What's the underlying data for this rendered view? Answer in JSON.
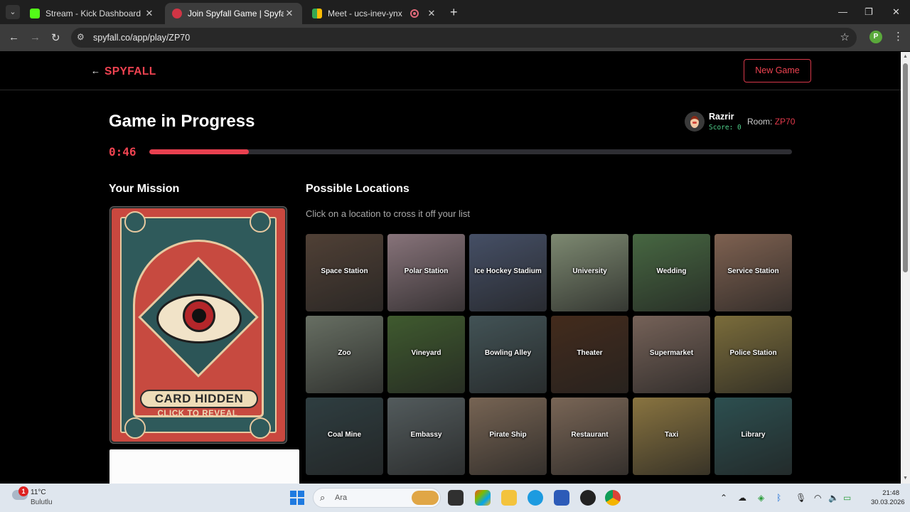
{
  "browser": {
    "tabs": [
      {
        "label": "Stream - Kick Dashboard",
        "active": false
      },
      {
        "label": "Join Spyfall Game | Spyfall Onli",
        "active": true
      },
      {
        "label": "Meet - ucs-inev-ynx",
        "active": false
      }
    ],
    "url": "spyfall.co/app/play/ZP70"
  },
  "header": {
    "brand": "SPYFALL",
    "new_game_label": "New Game"
  },
  "game": {
    "title": "Game in Progress",
    "timer": "0:46",
    "progress_fraction": 0.155,
    "player_name": "Razrir",
    "player_score": "Score: 0",
    "room_label": "Room:",
    "room_code": "ZP70"
  },
  "mission": {
    "title": "Your Mission",
    "card_text": "CARD HIDDEN",
    "card_subtext": "CLICK TO REVEAL"
  },
  "locations": {
    "title": "Possible Locations",
    "subtitle": "Click on a location to cross it off your list",
    "items": [
      {
        "label": "Space Station",
        "color": "#6b5648"
      },
      {
        "label": "Polar Station",
        "color": "#b59aa3"
      },
      {
        "label": "Ice Hockey Stadium",
        "color": "#5d6a88"
      },
      {
        "label": "University",
        "color": "#a7b797"
      },
      {
        "label": "Wedding",
        "color": "#5f8a58"
      },
      {
        "label": "Service Station",
        "color": "#a9826c"
      },
      {
        "label": "Zoo",
        "color": "#8a9484"
      },
      {
        "label": "Vineyard",
        "color": "#55793f"
      },
      {
        "label": "Bowling Alley",
        "color": "#596f73"
      },
      {
        "label": "Theater",
        "color": "#5a3a26"
      },
      {
        "label": "Supermarket",
        "color": "#9d8376"
      },
      {
        "label": "Police Station",
        "color": "#a4914f"
      },
      {
        "label": "Coal Mine",
        "color": "#3f5357"
      },
      {
        "label": "Embassy",
        "color": "#6f7a7c"
      },
      {
        "label": "Pirate Ship",
        "color": "#9f8670"
      },
      {
        "label": "Restaurant",
        "color": "#a28873"
      },
      {
        "label": "Taxi",
        "color": "#b79b56"
      },
      {
        "label": "Library",
        "color": "#3c6a6b"
      }
    ]
  },
  "taskbar": {
    "weather_temp": "11°C",
    "weather_desc": "Bulutlu",
    "notification_count": "1",
    "search_placeholder": "Ara",
    "time": "21:48",
    "date": "30.03.2026"
  }
}
